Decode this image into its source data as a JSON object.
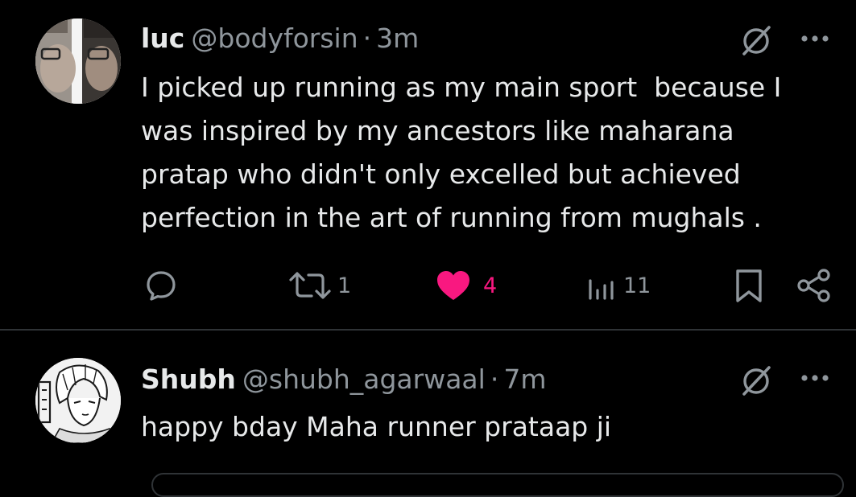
{
  "colors": {
    "background": "#000000",
    "text_primary": "#e7e9ea",
    "text_secondary": "#8f969c",
    "like_active": "#f91880",
    "divider": "#2f3336"
  },
  "tweets": [
    {
      "author_name": "luc",
      "handle": "@bodyforsin",
      "separator": "·",
      "time": "3m",
      "text": "I picked up running as my main sport  because I\nwas inspired by my ancestors like maharana\npratap who didn't only excelled but achieved\nperfection in the art of running from mughals .",
      "avatar_icon": "photo-avatar",
      "actions": {
        "reply": {
          "icon": "reply-icon",
          "count": ""
        },
        "retweet": {
          "icon": "retweet-icon",
          "count": "1"
        },
        "like": {
          "icon": "heart-filled-icon",
          "count": "4",
          "active": true
        },
        "views": {
          "icon": "views-icon",
          "count": "11"
        },
        "bookmark": {
          "icon": "bookmark-icon"
        },
        "share": {
          "icon": "share-icon"
        }
      }
    },
    {
      "author_name": "Shubh",
      "handle": "@shubh_agarwaal",
      "separator": "·",
      "time": "7m",
      "text": "happy bday Maha runner prataap ji",
      "avatar_icon": "manga-drawing-avatar"
    }
  ]
}
